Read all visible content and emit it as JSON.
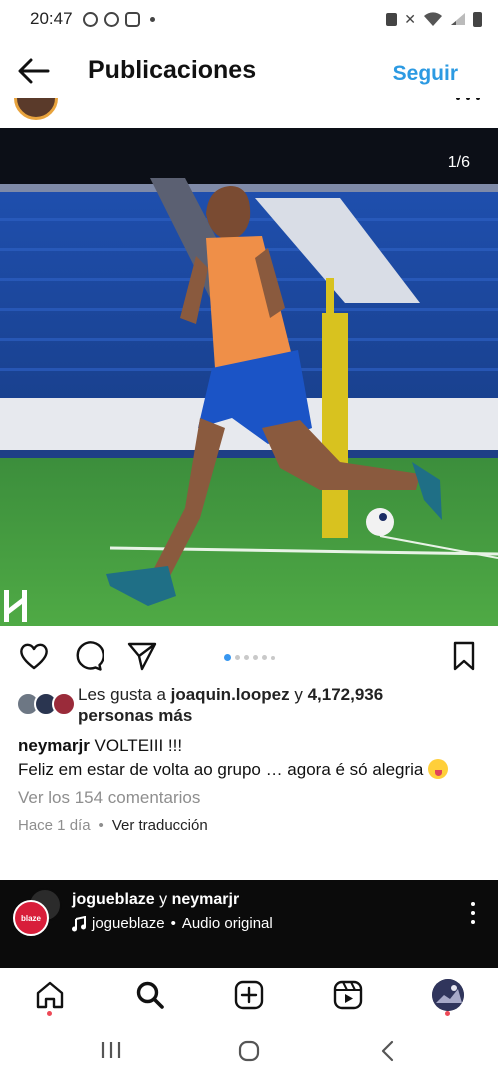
{
  "status_bar": {
    "time": "20:47"
  },
  "header": {
    "title": "Publicaciones",
    "follow_label": "Seguir"
  },
  "post": {
    "image_counter": "1/6",
    "carousel": {
      "total": 6,
      "active_index": 0
    },
    "likes": {
      "prefix": "Les gusta a ",
      "user": "joaquin.loopez",
      "connector": " y ",
      "count": "4,172,936",
      "suffix": "personas más"
    },
    "caption": {
      "username": "neymarjr",
      "title_text": " VOLTEIII !!!",
      "body": "Feliz em estar de volta ao grupo … agora é só alegria"
    },
    "comments_link": "Ver los 154 comentarios",
    "time_ago": "Hace 1 día",
    "separator": "•",
    "translate_label": "Ver traducción"
  },
  "reel_banner": {
    "users": "jogueblaze",
    "users_connector": " y ",
    "users_second": "neymarjr",
    "audio_user": "jogueblaze",
    "audio_separator": " • ",
    "audio_label": "Audio original",
    "brand_badge": "blaze"
  },
  "bottom_nav": {
    "items": [
      "home-icon",
      "search-icon",
      "create-icon",
      "reels-icon",
      "profile-avatar"
    ],
    "active": "search-icon"
  },
  "colors": {
    "accent_blue": "#2c9ae2",
    "active_dot": "#3897f0",
    "notification_red": "#ed4956",
    "secondary_text": "#8e8e8e"
  }
}
